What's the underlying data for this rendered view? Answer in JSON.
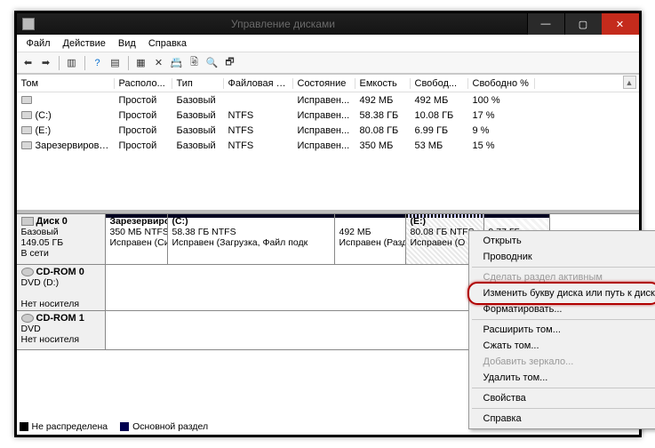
{
  "window": {
    "title": "Управление дисками"
  },
  "menu": {
    "file": "Файл",
    "action": "Действие",
    "view": "Вид",
    "help": "Справка"
  },
  "columns": {
    "vol": "Том",
    "layout": "Располо...",
    "type": "Тип",
    "fs": "Файловая с...",
    "status": "Состояние",
    "cap": "Емкость",
    "free": "Свобод...",
    "freepct": "Свободно %"
  },
  "volumes": [
    {
      "name": "",
      "layout": "Простой",
      "type": "Базовый",
      "fs": "",
      "status": "Исправен...",
      "cap": "492 МБ",
      "free": "492 МБ",
      "pct": "100 %"
    },
    {
      "name": "(C:)",
      "layout": "Простой",
      "type": "Базовый",
      "fs": "NTFS",
      "status": "Исправен...",
      "cap": "58.38 ГБ",
      "free": "10.08 ГБ",
      "pct": "17 %"
    },
    {
      "name": "(E:)",
      "layout": "Простой",
      "type": "Базовый",
      "fs": "NTFS",
      "status": "Исправен...",
      "cap": "80.08 ГБ",
      "free": "6.99 ГБ",
      "pct": "9 %"
    },
    {
      "name": "Зарезервировано...",
      "layout": "Простой",
      "type": "Базовый",
      "fs": "NTFS",
      "status": "Исправен...",
      "cap": "350 МБ",
      "free": "53 МБ",
      "pct": "15 %"
    }
  ],
  "disk0": {
    "header": "Диск 0",
    "type": "Базовый",
    "size": "149.05 ГБ",
    "status": "В сети",
    "parts": [
      {
        "title": "Зарезервиров",
        "l2": "350 МБ NTFS",
        "l3": "Исправен (Сис"
      },
      {
        "title": "(C:)",
        "l2": "58.38 ГБ NTFS",
        "l3": "Исправен (Загрузка, Файл подк"
      },
      {
        "title": "",
        "l2": "492 МБ",
        "l3": "Исправен (Разд"
      },
      {
        "title": "(E:)",
        "l2": "80.08 ГБ NTFS",
        "l3": "Исправен (О"
      },
      {
        "title": "",
        "l2": "9.77 ГБ",
        "l3": ""
      }
    ]
  },
  "cd0": {
    "header": "CD-ROM 0",
    "sub": "DVD (D:)",
    "status": "Нет носителя"
  },
  "cd1": {
    "header": "CD-ROM 1",
    "sub": "DVD",
    "status": "Нет носителя"
  },
  "legend": {
    "unalloc": "Не распределена",
    "primary": "Основной раздел"
  },
  "ctx": {
    "open": "Открыть",
    "explorer": "Проводник",
    "active": "Сделать раздел активным",
    "change": "Изменить букву диска или путь к диску...",
    "format": "Форматировать...",
    "extend": "Расширить том...",
    "shrink": "Сжать том...",
    "mirror": "Добавить зеркало...",
    "delete": "Удалить том...",
    "props": "Свойства",
    "help": "Справка"
  }
}
